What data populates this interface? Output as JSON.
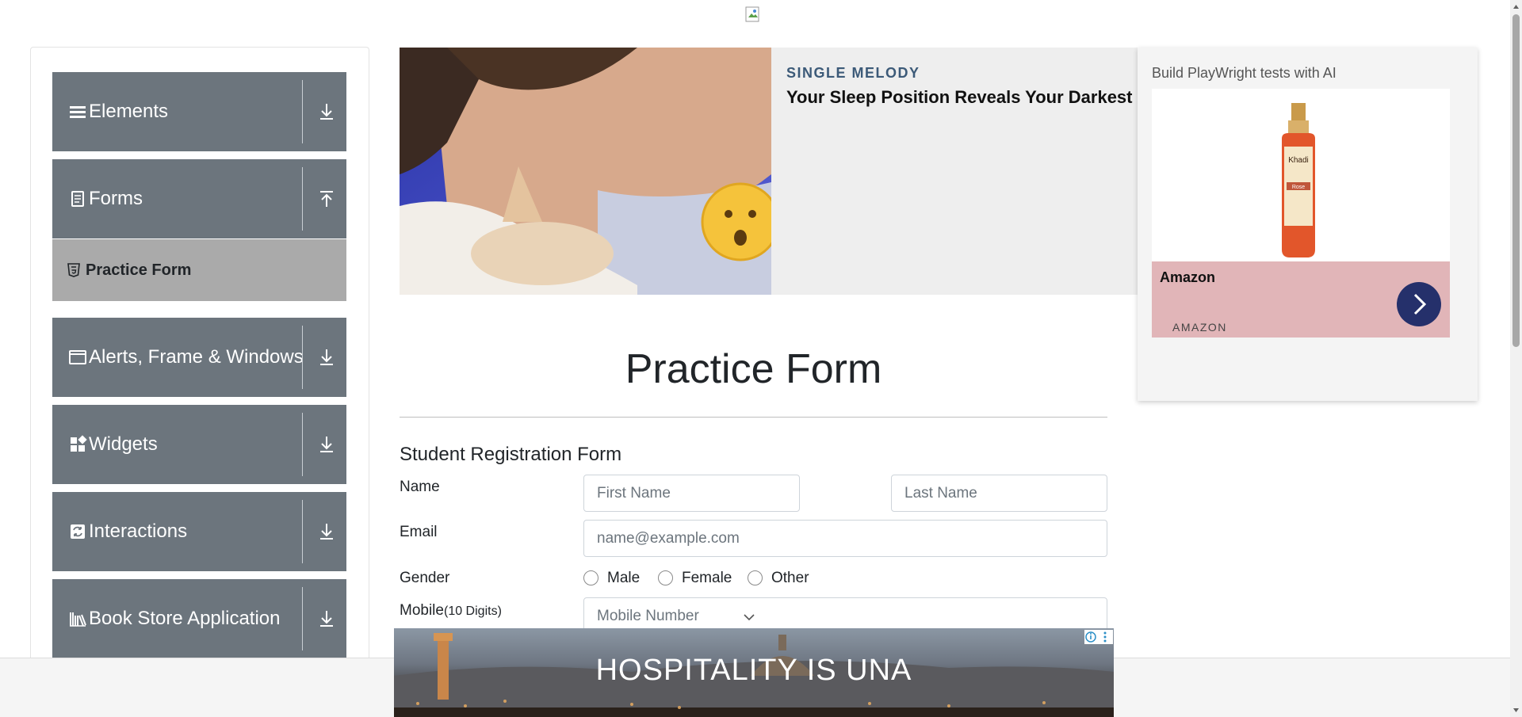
{
  "sidebar": {
    "groups": [
      {
        "label": "Elements",
        "icon": "hamburger-icon",
        "expanded": false
      },
      {
        "label": "Forms",
        "icon": "document-icon",
        "expanded": true
      },
      {
        "label": "Alerts, Frame & Windows",
        "icon": "window-icon",
        "expanded": false
      },
      {
        "label": "Widgets",
        "icon": "widgets-icon",
        "expanded": false
      },
      {
        "label": "Interactions",
        "icon": "interactions-icon",
        "expanded": false
      },
      {
        "label": "Book Store Application",
        "icon": "books-icon",
        "expanded": false
      }
    ],
    "active_item": {
      "label": "Practice Form",
      "icon": "html5-icon"
    }
  },
  "ad_top": {
    "source": "SINGLE MELODY",
    "headline": "Your Sleep Position Reveals Your Darkest Secret"
  },
  "ad_side": {
    "alt_text": "Build PlayWright tests with AI",
    "brand": "Amazon",
    "brand_sub": "AMAZON",
    "product_label": "Khadi",
    "product_variant": "Rose",
    "band_color": "#e1b5b8",
    "button_color": "#25306b"
  },
  "form": {
    "title": "Practice Form",
    "subtitle": "Student Registration Form",
    "name_label": "Name",
    "first_name_placeholder": "First Name",
    "last_name_placeholder": "Last Name",
    "email_label": "Email",
    "email_placeholder": "name@example.com",
    "gender_label": "Gender",
    "genders": [
      "Male",
      "Female",
      "Other"
    ],
    "mobile_label": "Mobile",
    "mobile_hint": "(10 Digits)",
    "mobile_placeholder": "Mobile Number"
  },
  "ad_bottom": {
    "text": "HOSPITALITY IS UNA"
  },
  "colors": {
    "sidebar_group": "#6c757d",
    "active_item": "#aaaaaa"
  }
}
